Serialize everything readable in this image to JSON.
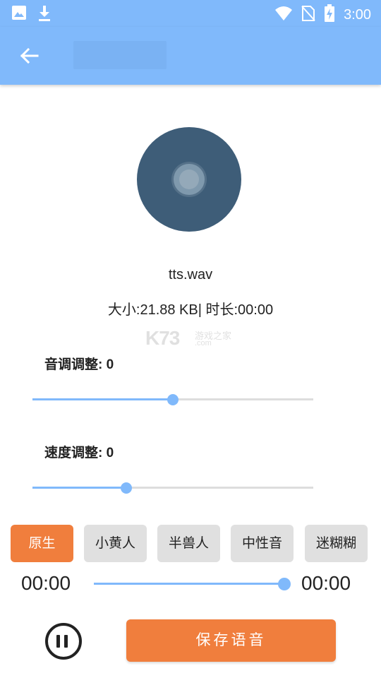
{
  "status_bar": {
    "time": "3:00",
    "left_icons": [
      "image-icon",
      "download-icon"
    ],
    "right_icons": [
      "wifi-icon",
      "no-sim-icon",
      "battery-charging-icon"
    ]
  },
  "app_bar": {
    "back_icon": "arrow-left-icon",
    "title": ""
  },
  "file": {
    "name": "tts.wav",
    "info": "大小:21.88 KB| 时长:00:00"
  },
  "watermark": {
    "main": "K73",
    "sub1": "游戏之家",
    "sub2": ".com"
  },
  "pitch": {
    "label": "音调调整: 0",
    "value": 0.5
  },
  "speed": {
    "label": "速度调整: 0",
    "value": 0.335
  },
  "voices": [
    {
      "label": "原生",
      "active": true
    },
    {
      "label": "小黄人",
      "active": false
    },
    {
      "label": "半兽人",
      "active": false
    },
    {
      "label": "中性音",
      "active": false
    },
    {
      "label": "迷糊糊",
      "active": false
    }
  ],
  "player": {
    "current_time": "00:00",
    "total_time": "00:00",
    "progress": 1.0,
    "pause_icon": "pause-icon"
  },
  "save_button": "保存语音",
  "colors": {
    "primary": "#80b9fb",
    "accent": "#f07e3d",
    "disc": "#3e5d78"
  }
}
